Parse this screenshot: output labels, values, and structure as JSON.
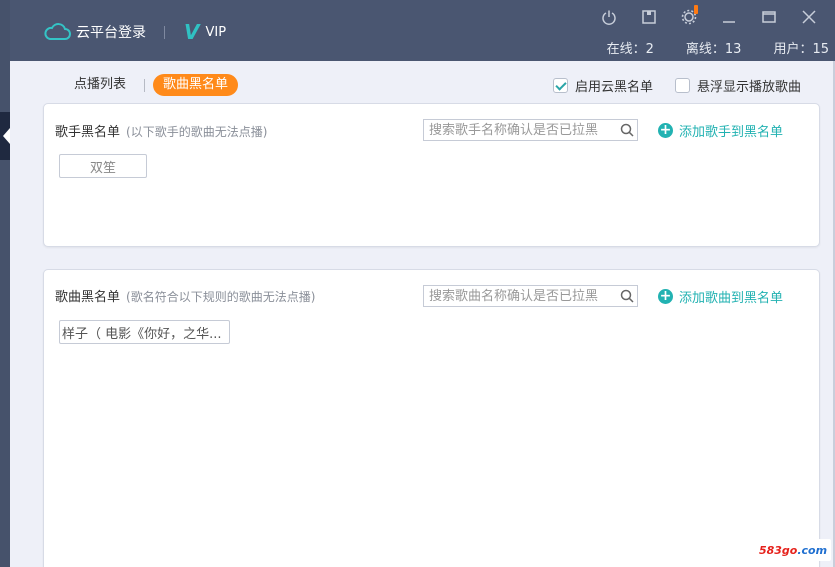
{
  "header": {
    "title": "云平台登录",
    "vip_letter": "V",
    "vip_label": "VIP",
    "stats": {
      "online": "在线：2",
      "offline": "离线：13",
      "users": "用户：15"
    }
  },
  "tabs": [
    {
      "label": "点播列表",
      "active": false
    },
    {
      "label": "歌曲黑名单",
      "active": true
    }
  ],
  "options": {
    "cloud_blacklist": {
      "label": "启用云黑名单",
      "checked": true
    },
    "float_display": {
      "label": "悬浮显示播放歌曲",
      "checked": false
    }
  },
  "singer_blacklist": {
    "title": "歌手黑名单",
    "subtitle": "(以下歌手的歌曲无法点播)",
    "search_placeholder": "搜索歌手名称确认是否已拉黑",
    "add_label": "添加歌手到黑名单",
    "items": [
      "双笙"
    ]
  },
  "song_blacklist": {
    "title": "歌曲黑名单",
    "subtitle": "(歌名符合以下规则的歌曲无法点播)",
    "search_placeholder": "搜索歌曲名称确认是否已拉黑",
    "add_label": "添加歌曲到黑名单",
    "items": [
      "样子（ 电影《你好，之华..."
    ]
  },
  "watermark": {
    "num": "583go",
    "dom": ".com"
  },
  "colors": {
    "header_bg": "#4a5671",
    "accent_orange": "#ff8a1a",
    "accent_teal": "#22b2b2",
    "content_bg": "#eef0f8"
  },
  "icons": [
    "cloud-icon",
    "power-icon",
    "save-icon",
    "gear-icon",
    "minimize-icon",
    "maximize-icon",
    "close-icon",
    "search-icon",
    "plus-circle-icon"
  ]
}
